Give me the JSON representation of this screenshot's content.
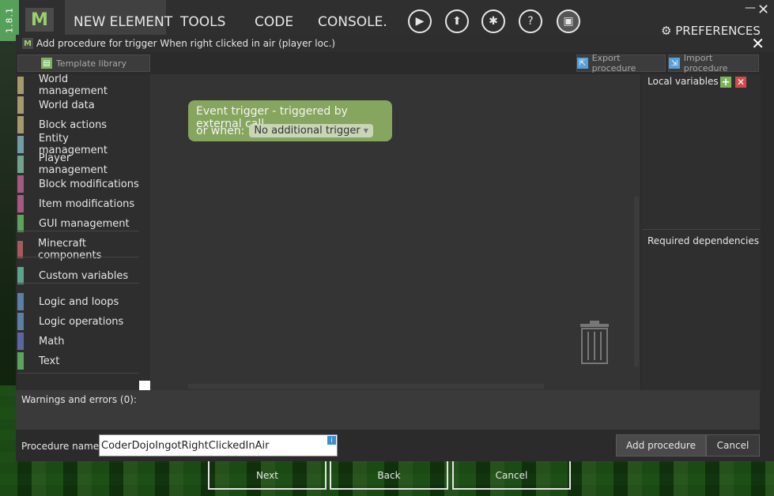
{
  "app": {
    "version": "1.8.1",
    "logo_text": "M",
    "menu": [
      "NEW ELEMENT",
      "TOOLS",
      "CODE",
      "CONSOLE."
    ],
    "preferences_label": "PREFERENCES",
    "toolbar_icons": [
      "run-client-icon",
      "export-icon",
      "debug-icon",
      "help-icon",
      "workspace-settings-icon"
    ]
  },
  "dialog": {
    "title": "Add procedure for trigger When right clicked in air (player loc.)",
    "template_library_label": "Template library",
    "export_label": "Export procedure",
    "import_label": "Import procedure"
  },
  "palette": {
    "categories": [
      {
        "label": "World management",
        "color": "#a59a6a"
      },
      {
        "label": "World data",
        "color": "#a59a6a"
      },
      {
        "label": "Block actions",
        "color": "#a59a6a"
      },
      {
        "label": "Entity management",
        "color": "#6f9fa5"
      },
      {
        "label": "Player management",
        "color": "#6fa58f"
      },
      {
        "label": "Block modifications",
        "color": "#a55b80"
      },
      {
        "label": "Item modifications",
        "color": "#a55b80"
      },
      {
        "label": "GUI management",
        "color": "#5ba55b"
      },
      {
        "label": "Minecraft components",
        "color": "#a55b5b"
      },
      {
        "label": "Custom variables",
        "color": "#5ba58c"
      },
      {
        "label": "Logic and loops",
        "color": "#5b80a5"
      },
      {
        "label": "Logic operations",
        "color": "#5b80a5"
      },
      {
        "label": "Math",
        "color": "#5b67a5"
      },
      {
        "label": "Text",
        "color": "#5ba55b"
      }
    ]
  },
  "workspace": {
    "event_block_line1": "Event trigger - triggered by external call",
    "event_block_prefix": "or when:",
    "event_block_dropdown": "No additional trigger",
    "event_block_color": "#86a55e"
  },
  "right_panel": {
    "local_variables_label": "Local variables",
    "required_dependencies_label": "Required dependencies"
  },
  "warnings": {
    "label": "Warnings and errors (0):"
  },
  "bottom": {
    "procedure_name_label": "Procedure name:",
    "procedure_name_value": "CoderDojoIngotRightClickedInAir",
    "add_label": "Add procedure",
    "cancel_label": "Cancel"
  },
  "wizard": {
    "next_label": "Next",
    "back_label": "Back",
    "cancel_label": "Cancel"
  }
}
